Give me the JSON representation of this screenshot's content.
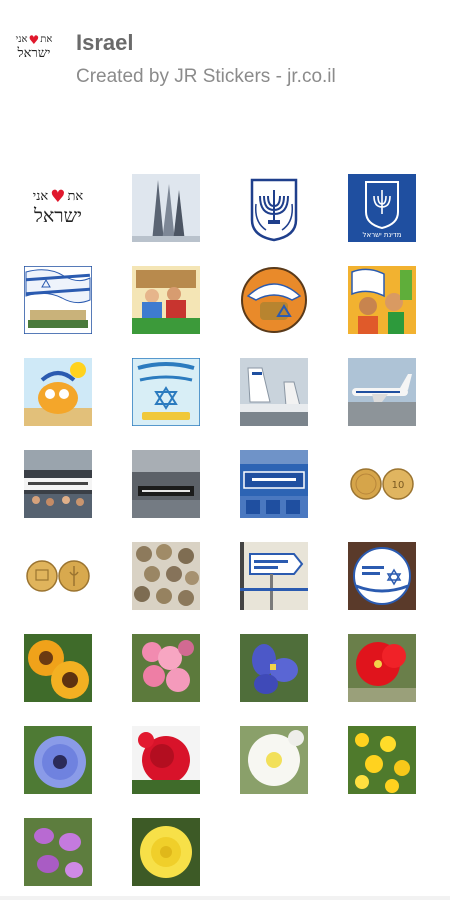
{
  "header": {
    "pack_icon": {
      "line1_left": "אני",
      "line1_right": "את",
      "line2": "ישראל"
    },
    "title": "Israel",
    "subtitle": "Created by JR Stickers - jr.co.il"
  },
  "stickers": [
    {
      "name": "ani-ohev-et-israel-logo",
      "line1_left": "אני",
      "line1_right": "את",
      "line2": "ישראל"
    },
    {
      "name": "tower-monument"
    },
    {
      "name": "menorah-emblem"
    },
    {
      "name": "state-emblem-blue",
      "caption": "מדינת ישראל"
    },
    {
      "name": "flags-knesset"
    },
    {
      "name": "cartoon-family"
    },
    {
      "name": "cartoon-hat-badge"
    },
    {
      "name": "cartoon-people-flag"
    },
    {
      "name": "cartoon-sun-character"
    },
    {
      "name": "proud-to-be-israeli-sign"
    },
    {
      "name": "el-al-plane-tail"
    },
    {
      "name": "el-al-plane-runway"
    },
    {
      "name": "airport-crowd-banner"
    },
    {
      "name": "airport-welcome-sign"
    },
    {
      "name": "welcome-blue-sign"
    },
    {
      "name": "ten-shekel-coins"
    },
    {
      "name": "gold-coins-pair"
    },
    {
      "name": "old-coins-pile"
    },
    {
      "name": "coming-home-sign"
    },
    {
      "name": "lets-go-home-sign"
    },
    {
      "name": "sunflowers"
    },
    {
      "name": "pink-geranium"
    },
    {
      "name": "purple-iris"
    },
    {
      "name": "red-hibiscus"
    },
    {
      "name": "blue-anemone"
    },
    {
      "name": "red-rose"
    },
    {
      "name": "white-petunia"
    },
    {
      "name": "yellow-wildflowers"
    },
    {
      "name": "purple-orchids"
    },
    {
      "name": "yellow-flower"
    }
  ]
}
